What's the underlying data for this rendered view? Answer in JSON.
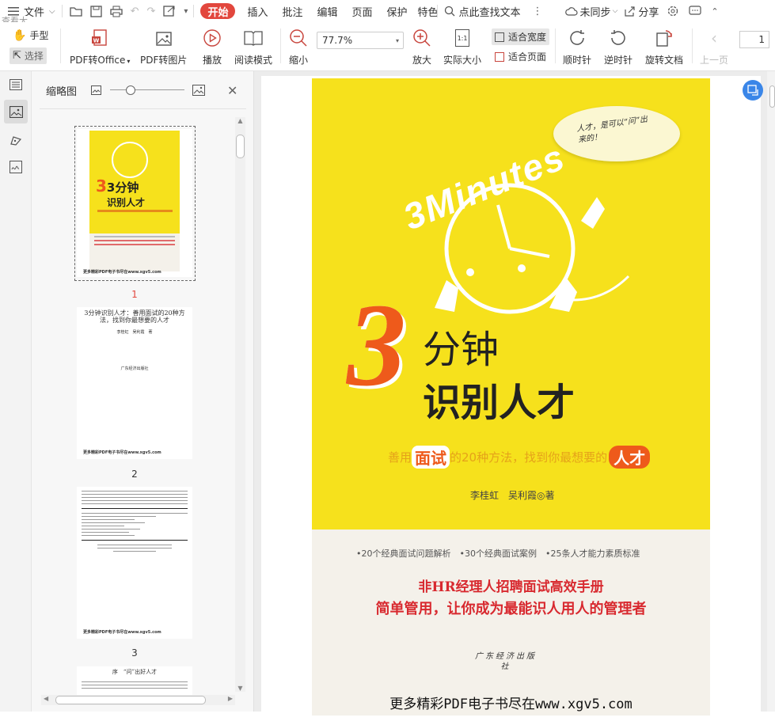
{
  "menu": {
    "file": "文件",
    "tabs": [
      "开始",
      "插入",
      "批注",
      "编辑",
      "页面",
      "保护",
      "特色"
    ],
    "active_tab": "开始",
    "search": "点此查找文本",
    "sync": "未同步",
    "share": "分享",
    "tooltip": "查看大图"
  },
  "ribbon": {
    "hand": "手型",
    "select": "选择",
    "pdf_office": "PDF转Office",
    "pdf_image": "PDF转图片",
    "play": "播放",
    "read_mode": "阅读模式",
    "zoom_out": "缩小",
    "zoom_value": "77.7%",
    "zoom_in": "放大",
    "actual_size": "实际大小",
    "actual_icon": "1:1",
    "fit_width": "适合宽度",
    "fit_page": "适合页面",
    "rotate_cw": "顺时针",
    "rotate_ccw": "逆时针",
    "rotate_doc": "旋转文档",
    "prev_page": "上一页",
    "page_input": "1"
  },
  "thumbnails": {
    "title": "缩略图",
    "pages": [
      {
        "num": "1",
        "active": true
      },
      {
        "num": "2"
      },
      {
        "num": "3"
      }
    ],
    "p1_title": "3分钟",
    "p1_title2": "识别人才",
    "p1_footer": "更多精彩PDF电子书尽在www.xgv5.com",
    "p2_title": "3分钟识别人才：善用面试的20种方法，找到你最想要的人才",
    "p2_authors": "李桂虹　吴利霞　著",
    "p2_publisher": "广东经济出版社",
    "p2_footer": "更多精彩PDF电子书尽在www.xgv5.com",
    "p3_footer": "更多精彩PDF电子书尽在www.xgv5.com",
    "p4_title": "序　“问”出好人才"
  },
  "cover": {
    "bubble": "人才，是可以“问”出来的！",
    "minutes": "3Minutes",
    "big3": "3",
    "title1": "分钟",
    "title2": "识别人才",
    "subtitle_a": "善用",
    "subtitle_b": "面试",
    "subtitle_c": "的20种方法，找到你最想要的",
    "subtitle_d": "人才",
    "authors": "李桂虹　吴利霞◎著",
    "features": "•20个经典面试问题解析　•30个经典面试案例　•25条人才能力素质标准",
    "tagline1": "非HR经理人招聘面试高效手册",
    "tagline2": "简单管用，让你成为最能识人用人的管理者",
    "publisher1": "广东经济出版社",
    "footer": "更多精彩PDF电子书尽在www.xgv5.com"
  },
  "colors": {
    "accent": "#e2473d",
    "cover_yellow": "#f6e11c",
    "cover_orange": "#ee5a1b",
    "tagline_red": "#d8292f"
  }
}
